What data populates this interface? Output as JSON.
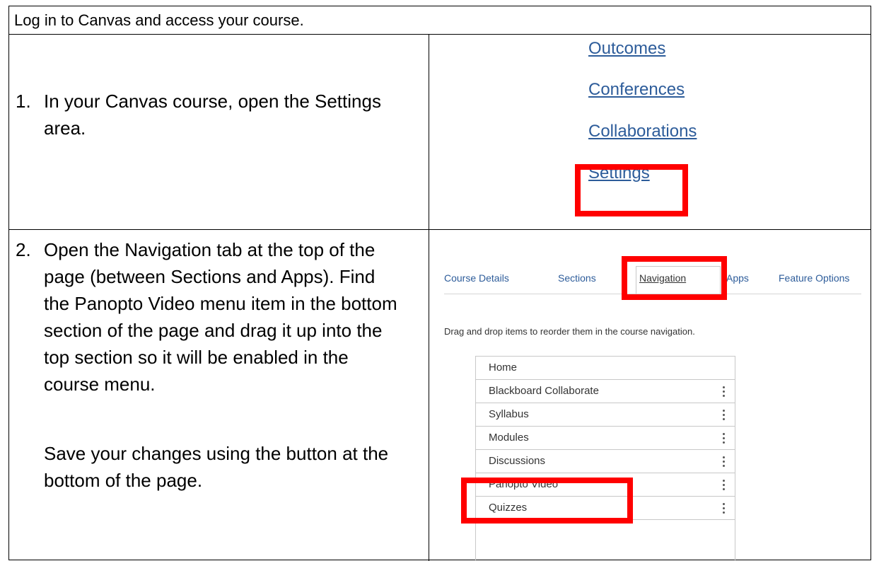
{
  "header": {
    "text": "Log in to Canvas and access your course."
  },
  "steps": [
    {
      "number": "1.",
      "text": "In your Canvas course, open the Settings area."
    },
    {
      "number": "2.",
      "text": "Open the Navigation tab at the top of the page (between Sections and Apps). Find the Panopto Video menu item in the bottom section of the page and drag it up into the top section so it will be enabled in the course menu.",
      "note": "Save your changes using the button at the bottom of the page."
    }
  ],
  "menu_links": [
    "Outcomes",
    "Conferences",
    "Collaborations",
    "Settings"
  ],
  "tabs": [
    "Course Details",
    "Sections",
    "Navigation",
    "Apps",
    "Feature Options"
  ],
  "instruction": "Drag and drop items to reorder them in the course navigation.",
  "nav_items": [
    {
      "label": "Home",
      "has_menu": false
    },
    {
      "label": "Blackboard Collaborate",
      "has_menu": true
    },
    {
      "label": "Syllabus",
      "has_menu": true
    },
    {
      "label": "Modules",
      "has_menu": true
    },
    {
      "label": "Discussions",
      "has_menu": true
    },
    {
      "label": "Panopto Video",
      "has_menu": true
    },
    {
      "label": "Quizzes",
      "has_menu": true
    }
  ],
  "colors": {
    "link": "#2D5C9A",
    "highlight": "#FF0000"
  }
}
